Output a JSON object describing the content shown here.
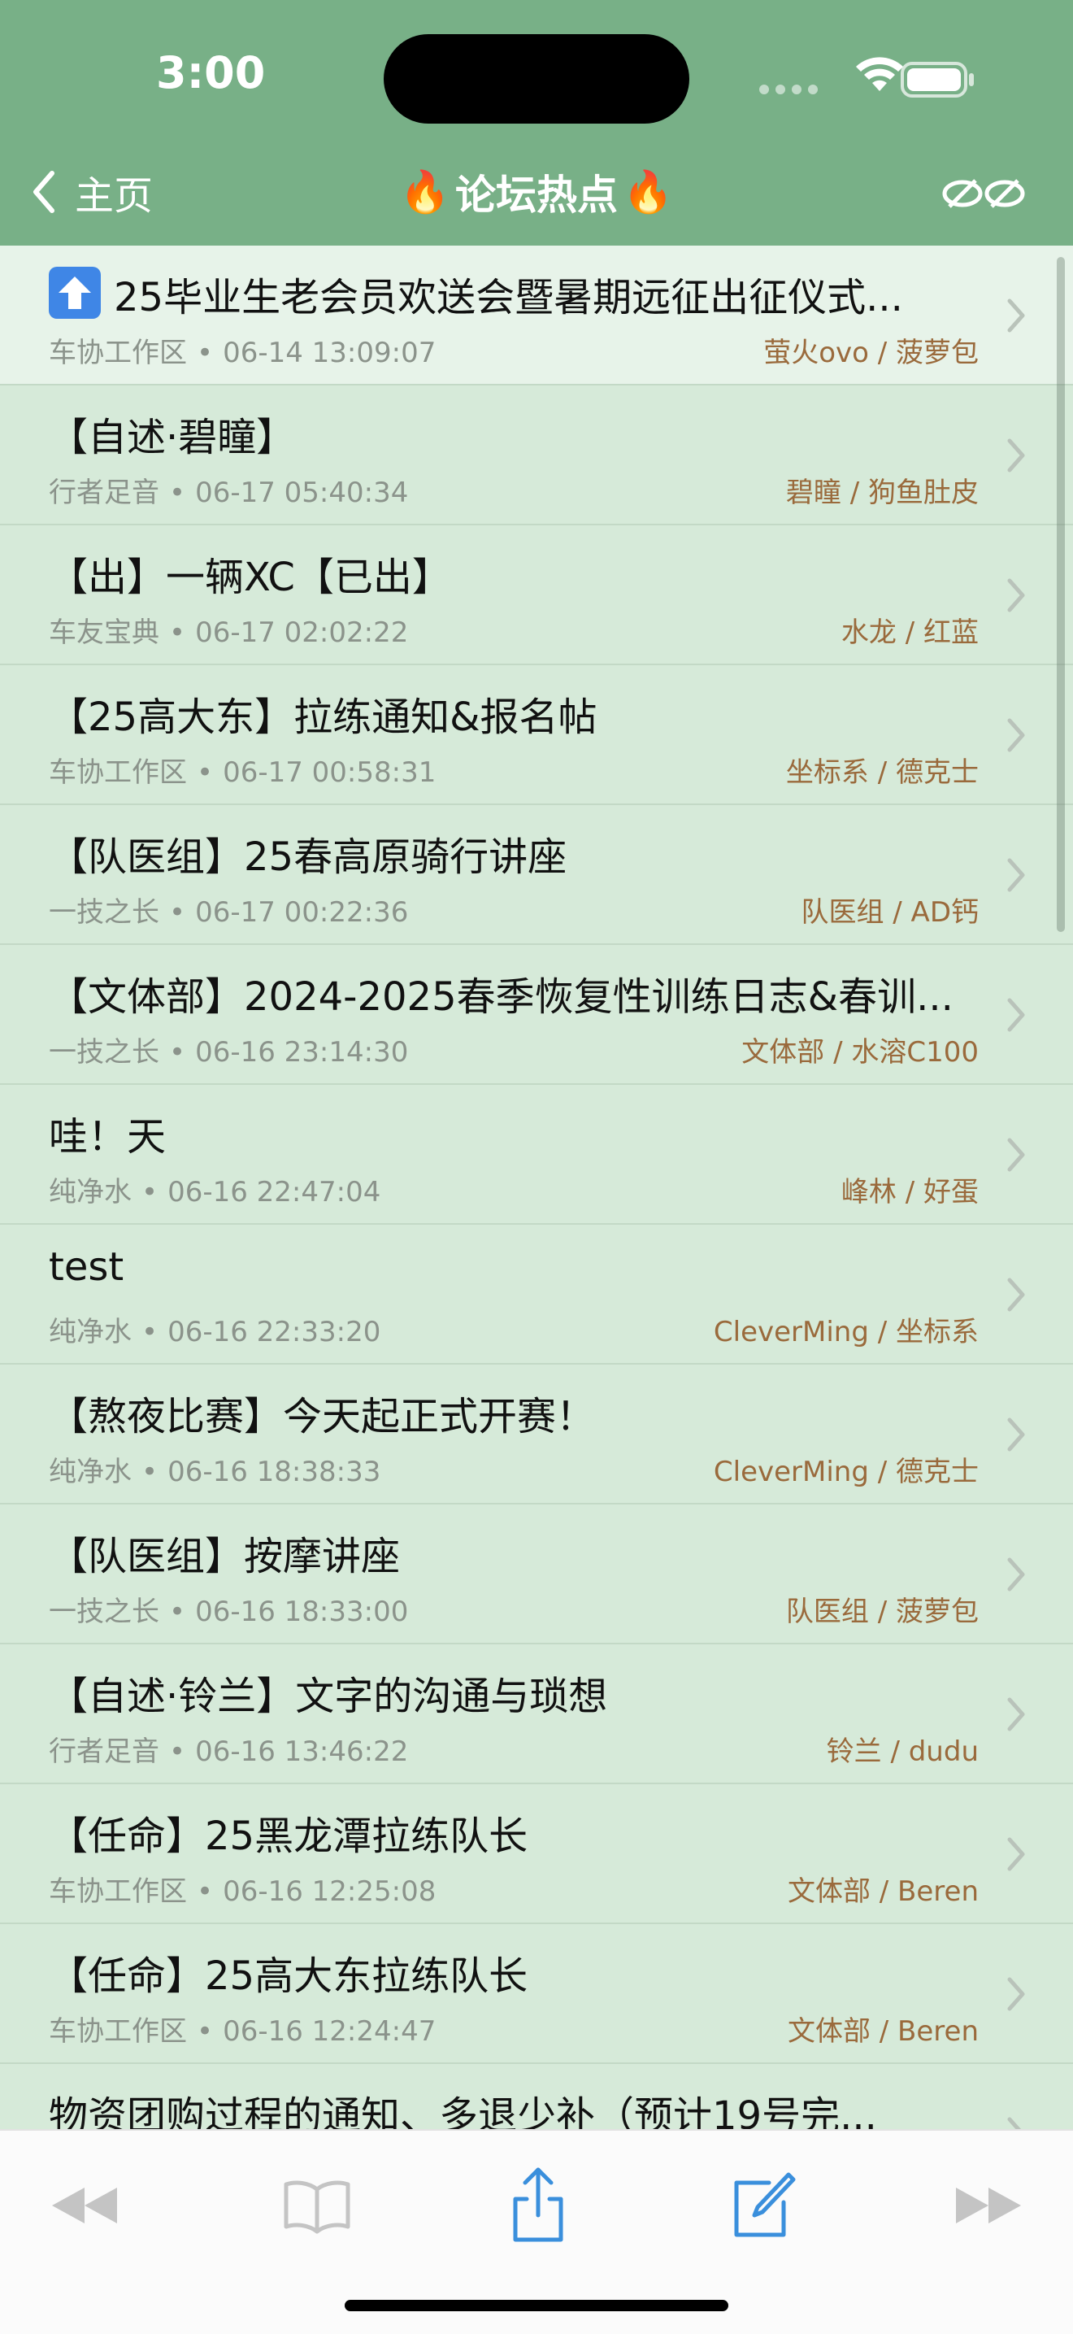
{
  "status_bar": {
    "time": "3:00"
  },
  "nav": {
    "back_label": "主页",
    "title": "论坛热点"
  },
  "posts": [
    {
      "title": "25毕业生老会员欢送会暨暑期远征出征仪式...",
      "board": "车协工作区",
      "time": "06-14 13:09:07",
      "authors": "萤火ovo / 菠萝包",
      "pinned": true
    },
    {
      "title": "【自述·碧瞳】",
      "board": "行者足音",
      "time": "06-17 05:40:34",
      "authors": "碧瞳 / 狗鱼肚皮"
    },
    {
      "title": "【出】一辆XC【已出】",
      "board": "车友宝典",
      "time": "06-17 02:02:22",
      "authors": "水龙 / 红蓝"
    },
    {
      "title": "【25高大东】拉练通知&报名帖",
      "board": "车协工作区",
      "time": "06-17 00:58:31",
      "authors": "坐标系 / 德克士"
    },
    {
      "title": "【队医组】25春高原骑行讲座",
      "board": "一技之长",
      "time": "06-17 00:22:36",
      "authors": "队医组 / AD钙"
    },
    {
      "title": "【文体部】2024-2025春季恢复性训练日志&春训...",
      "board": "一技之长",
      "time": "06-16 23:14:30",
      "authors": "文体部 / 水溶C100"
    },
    {
      "title": "哇！天",
      "board": "纯净水",
      "time": "06-16 22:47:04",
      "authors": "峰林 / 好蛋"
    },
    {
      "title": "test",
      "board": "纯净水",
      "time": "06-16 22:33:20",
      "authors": "CleverMing / 坐标系"
    },
    {
      "title": "【熬夜比赛】今天起正式开赛！",
      "board": "纯净水",
      "time": "06-16 18:38:33",
      "authors": "CleverMing / 德克士"
    },
    {
      "title": "【队医组】按摩讲座",
      "board": "一技之长",
      "time": "06-16 18:33:00",
      "authors": "队医组 / 菠萝包"
    },
    {
      "title": "【自述·铃兰】文字的沟通与琐想",
      "board": "行者足音",
      "time": "06-16 13:46:22",
      "authors": "铃兰 / dudu"
    },
    {
      "title": "【任命】25黑龙潭拉练队长",
      "board": "车协工作区",
      "time": "06-16 12:25:08",
      "authors": "文体部 / Beren"
    },
    {
      "title": "【任命】25高大东拉练队长",
      "board": "车协工作区",
      "time": "06-16 12:24:47",
      "authors": "文体部 / Beren"
    },
    {
      "title": "物资团购过程的通知、多退少补（预计19号完...",
      "board": "",
      "time": "",
      "authors": ""
    }
  ],
  "meta_separator": "•",
  "colors": {
    "header_bg": "#78b087",
    "list_bg": "#d6ead9",
    "author_text": "#9a6a3c",
    "toolbar_icon": "#3a8fdc",
    "toolbar_icon_disabled": "#c4c4c4"
  },
  "toolbar": {
    "icons": [
      "back-icon",
      "bookmarks-icon",
      "share-icon",
      "compose-icon",
      "forward-icon"
    ]
  }
}
